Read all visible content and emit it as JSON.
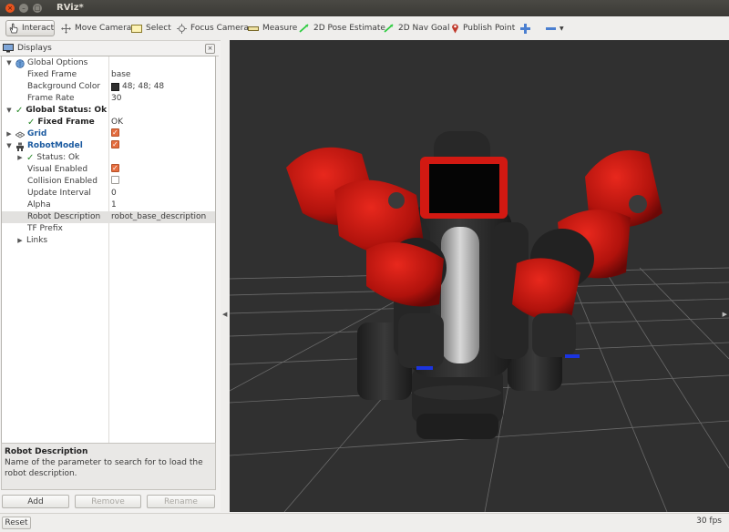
{
  "window": {
    "title": "RViz*"
  },
  "toolbar": {
    "tools": [
      {
        "label": "Interact",
        "icon": "hand-cursor-icon",
        "active": true
      },
      {
        "label": "Move Camera",
        "icon": "move-camera-icon"
      },
      {
        "label": "Select",
        "icon": "select-box-icon"
      },
      {
        "label": "Focus Camera",
        "icon": "focus-camera-icon"
      },
      {
        "label": "Measure",
        "icon": "ruler-icon"
      },
      {
        "label": "2D Pose Estimate",
        "icon": "pose-arrow-icon",
        "color": "#2ecc40"
      },
      {
        "label": "2D Nav Goal",
        "icon": "nav-arrow-icon",
        "color": "#2ecc40"
      },
      {
        "label": "Publish Point",
        "icon": "map-pin-icon",
        "color": "#c0392b"
      }
    ]
  },
  "displays_panel": {
    "title": "Displays",
    "rows": [
      {
        "indent": 0,
        "arrow": "▼",
        "icon": "globe-icon",
        "label": "Global Options",
        "value": ""
      },
      {
        "indent": 1,
        "label": "Fixed Frame",
        "value": "base"
      },
      {
        "indent": 1,
        "label": "Background Color",
        "value": "48; 48; 48",
        "swatch": "#303030"
      },
      {
        "indent": 1,
        "label": "Frame Rate",
        "value": "30"
      },
      {
        "indent": 0,
        "arrow": "▼",
        "icon": "check-icon",
        "label": "Global Status: Ok",
        "value": ""
      },
      {
        "indent": 1,
        "icon": "check-icon",
        "label": "Fixed Frame",
        "value": "OK"
      },
      {
        "indent": 0,
        "arrow": "▶",
        "icon": "grid-icon",
        "label": "Grid",
        "checkbox": true
      },
      {
        "indent": 0,
        "arrow": "▼",
        "icon": "robot-model-icon",
        "label": "RobotModel",
        "checkbox": true
      },
      {
        "indent": 1,
        "arrow": "▶",
        "icon": "check-icon",
        "label": "Status: Ok",
        "value": ""
      },
      {
        "indent": 1,
        "label": "Visual Enabled",
        "checkbox": true
      },
      {
        "indent": 1,
        "label": "Collision Enabled",
        "checkbox": false
      },
      {
        "indent": 1,
        "label": "Update Interval",
        "value": "0"
      },
      {
        "indent": 1,
        "label": "Alpha",
        "value": "1"
      },
      {
        "indent": 1,
        "label": "Robot Description",
        "value": "robot_base_description",
        "selected": true
      },
      {
        "indent": 1,
        "label": "TF Prefix",
        "value": ""
      },
      {
        "indent": 1,
        "arrow": "▶",
        "label": "Links",
        "value": ""
      }
    ],
    "description": {
      "title": "Robot Description",
      "text": "Name of the parameter to search for to load the robot description."
    },
    "buttons": {
      "add": "Add",
      "remove": "Remove",
      "rename": "Rename"
    }
  },
  "statusbar": {
    "reset": "Reset",
    "fps": "30 fps"
  },
  "colors": {
    "viewport_bg": "#303030",
    "robot_red": "#c8140f",
    "robot_dark": "#2a2a2a"
  }
}
